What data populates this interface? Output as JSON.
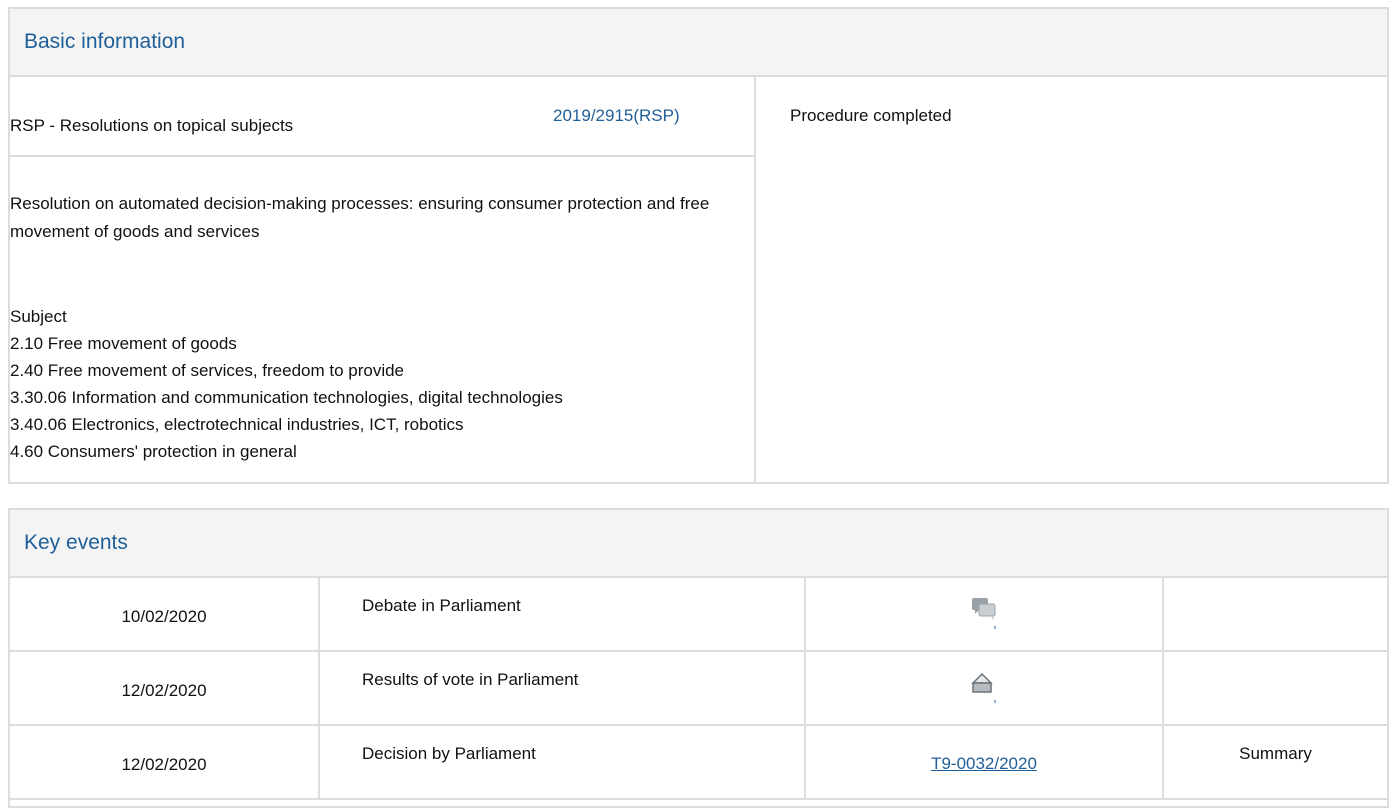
{
  "basic_information": {
    "header": "Basic information",
    "procedure_type": "RSP - Resolutions on topical subjects",
    "procedure_reference": "2019/2915(RSP)",
    "title": "Resolution on automated decision-making processes: ensuring consumer protection and free movement of goods and services",
    "subject_label": "Subject",
    "subjects": [
      "2.10 Free movement of goods",
      "2.40 Free movement of services, freedom to provide",
      "3.30.06 Information and communication technologies, digital technologies",
      "3.40.06 Electronics, electrotechnical industries, ICT, robotics",
      "4.60 Consumers' protection in general"
    ],
    "status": "Procedure completed"
  },
  "key_events": {
    "header": "Key events",
    "rows": [
      {
        "date": "10/02/2020",
        "event": "Debate in Parliament",
        "icon": "debate-icon",
        "document": "",
        "summary": ""
      },
      {
        "date": "12/02/2020",
        "event": "Results of vote in Parliament",
        "icon": "vote-icon",
        "document": "",
        "summary": ""
      },
      {
        "date": "12/02/2020",
        "event": "Decision by Parliament",
        "icon": "",
        "document": "T9-0032/2020",
        "summary": "Summary"
      }
    ]
  },
  "colors": {
    "link": "#1f5f99",
    "border": "#dcdcdc",
    "header_bg": "#f4f4f4"
  }
}
